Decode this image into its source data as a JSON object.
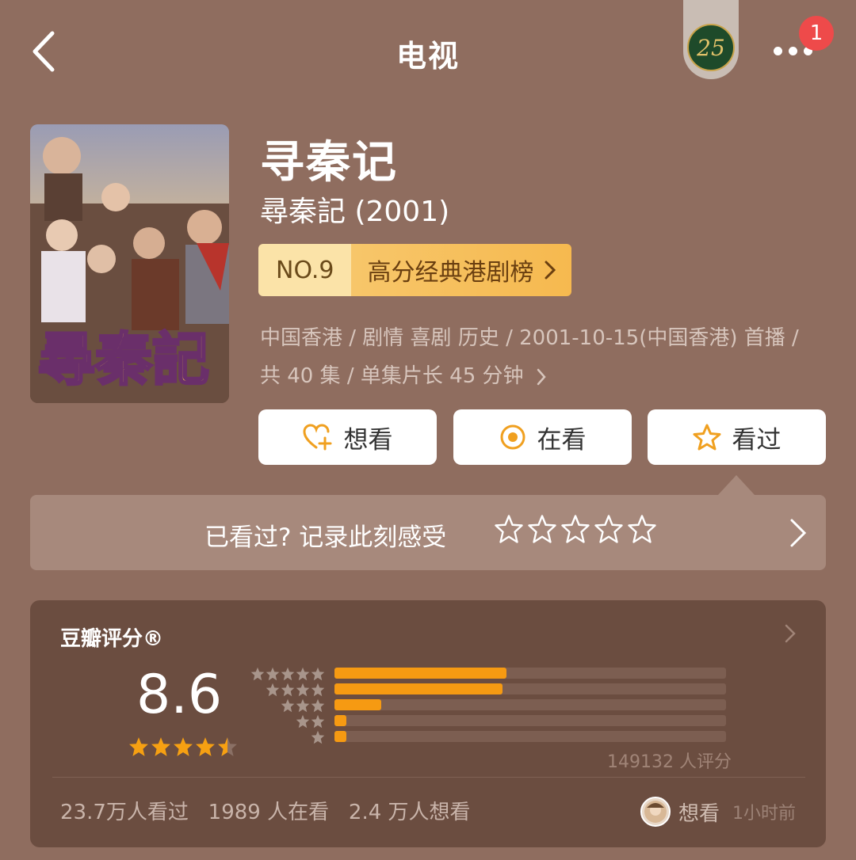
{
  "nav": {
    "title": "电视",
    "badge_text": "25",
    "notification_count": "1"
  },
  "subject": {
    "title": "寻秦记",
    "original_title": "尋秦記 (2001)",
    "rank_no": "NO.9",
    "rank_label": "高分经典港剧榜",
    "meta_line1": "中国香港 / 剧情 喜剧 历史 / 2001-10-15(中国香港) 首播 /",
    "meta_line2": "共 40 集 / 单集片长 45 分钟",
    "poster_art_text": "尋秦記"
  },
  "actions": {
    "want": "想看",
    "watching": "在看",
    "watched": "看过"
  },
  "record": {
    "prompt": "已看过? 记录此刻感受"
  },
  "rating": {
    "title": "豆瓣评分®",
    "score": "8.6",
    "score_stars": 4.5,
    "distribution": [
      {
        "stars": 5,
        "fraction": 0.44
      },
      {
        "stars": 4,
        "fraction": 0.43
      },
      {
        "stars": 3,
        "fraction": 0.12
      },
      {
        "stars": 2,
        "fraction": 0.03
      },
      {
        "stars": 1,
        "fraction": 0.03
      }
    ],
    "count_text": "149132 人评分",
    "stats_text": "23.7万人看过   1989 人在看   2.4 万人想看",
    "friend_action": "想看",
    "friend_time": "1小时前"
  },
  "colors": {
    "background": "#8f6d5f",
    "accent": "#f69a12",
    "card": "#6b4d40"
  }
}
